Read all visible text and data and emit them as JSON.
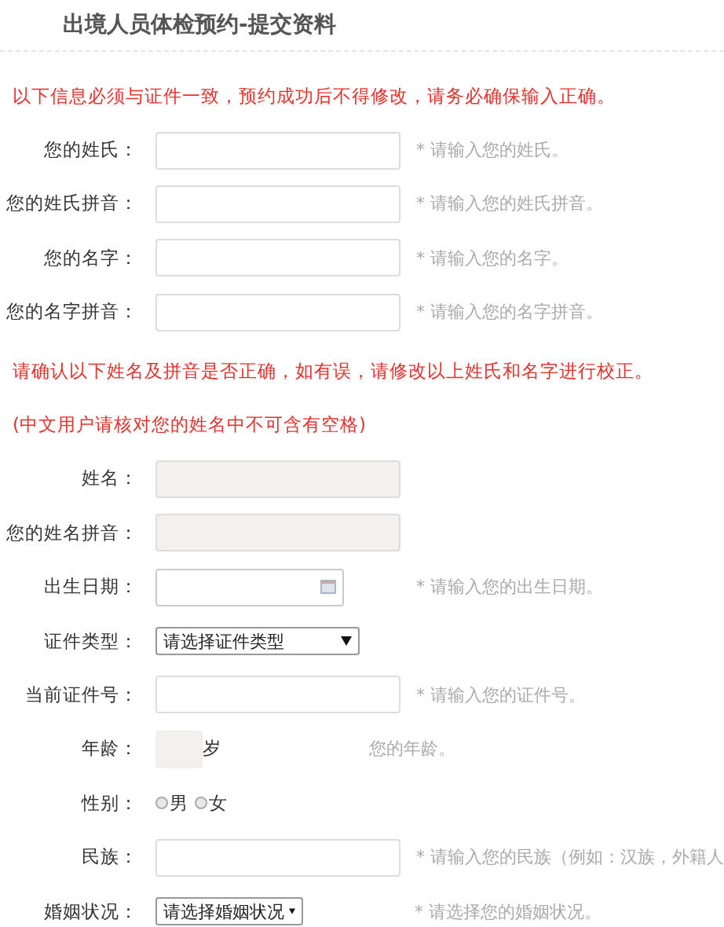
{
  "title": "出境人员体检预约-提交资料",
  "form": [
    {
      "kind": "notice",
      "text": "以下信息必须与证件一致，预约成功后不得修改，请务必确保输入正确。"
    },
    {
      "kind": "text",
      "label": "您的姓氏：",
      "hint": "* 请输入您的姓氏。"
    },
    {
      "kind": "text",
      "label": "您的姓氏拼音：",
      "hint": "* 请输入您的姓氏拼音。"
    },
    {
      "kind": "text",
      "label": "您的名字：",
      "hint": "* 请输入您的名字。"
    },
    {
      "kind": "text",
      "label": "您的名字拼音：",
      "hint": "* 请输入您的名字拼音。"
    },
    {
      "kind": "notice",
      "text": "请确认以下姓名及拼音是否正确，如有误，请修改以上姓氏和名字进行校正。"
    },
    {
      "kind": "notice",
      "text": "(中文用户请核对您的姓名中不可含有空格)"
    },
    {
      "kind": "readonly",
      "label": "姓名："
    },
    {
      "kind": "readonly",
      "label": "您的姓名拼音："
    },
    {
      "kind": "date",
      "label": "出生日期：",
      "hint": "* 请输入您的出生日期。"
    },
    {
      "kind": "select",
      "label": "证件类型：",
      "value": "请选择证件类型"
    },
    {
      "kind": "text",
      "label": "当前证件号：",
      "hint": "* 请输入您的证件号。"
    },
    {
      "kind": "age",
      "label": "年龄：",
      "unit": "岁",
      "hint": "您的年龄。"
    },
    {
      "kind": "radio",
      "label": "性别：",
      "options": [
        {
          "label": "男",
          "selected": false
        },
        {
          "label": "女",
          "selected": false
        }
      ]
    },
    {
      "kind": "text",
      "label": "民族：",
      "hint": "* 请输入您的民族（例如：汉族，外籍人"
    },
    {
      "kind": "select_small",
      "label": "婚姻状况：",
      "value": "请选择婚姻状况",
      "hint": "* 请选择您的婚姻状况。"
    }
  ]
}
